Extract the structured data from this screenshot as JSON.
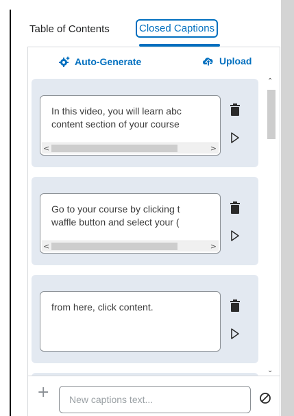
{
  "tabs": {
    "toc_label": "Table of Contents",
    "cc_label": "Closed Captions",
    "active": "Closed Captions"
  },
  "actions": {
    "auto_generate_label": "Auto-Generate",
    "upload_label": "Upload"
  },
  "captions": [
    {
      "text": "In this video, you will learn abc\ncontent section of your course"
    },
    {
      "text": "Go to your course by clicking t\nwaffle button and select your ("
    },
    {
      "text": "from here, click content."
    }
  ],
  "new_caption": {
    "placeholder": "New captions text..."
  },
  "colors": {
    "accent": "#006fbf",
    "card_bg": "#e3e9f1",
    "border": "#8a8f94"
  },
  "icons": {
    "add": "plus-icon",
    "clear": "cancel-icon",
    "delete": "trash-icon",
    "play": "play-icon",
    "auto": "gear-sparkle-icon",
    "upload": "cloud-upload-icon"
  }
}
